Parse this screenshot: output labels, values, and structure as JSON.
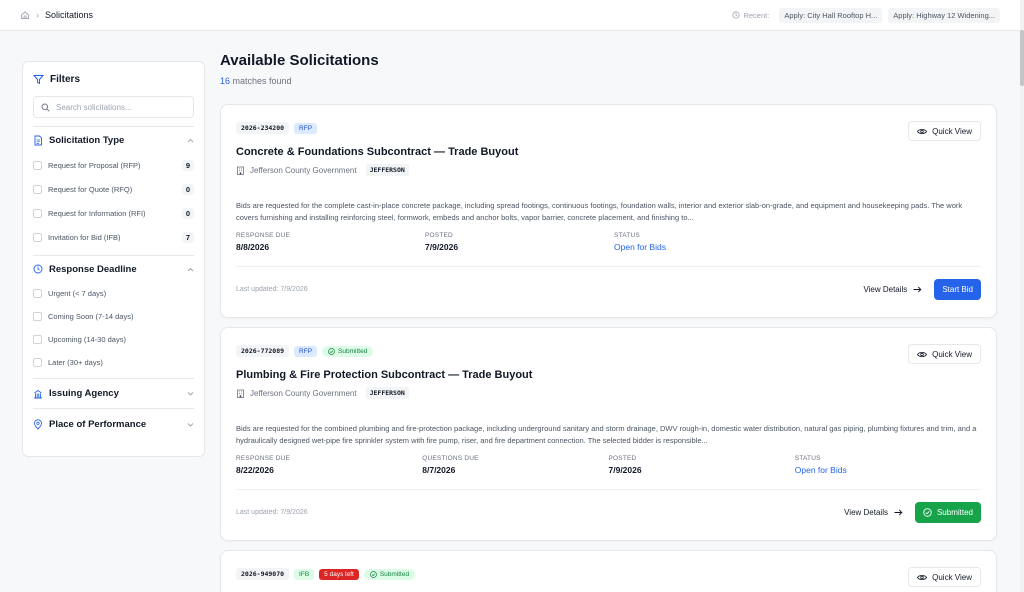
{
  "breadcrumb": {
    "current": "Solicitations"
  },
  "recent": {
    "label": "Recent:",
    "items": [
      "Apply: City Hall Rooftop H...",
      "Apply: Highway 12 Widening..."
    ]
  },
  "page": {
    "title": "Available Solicitations",
    "match_count": "16",
    "match_suffix": " matches found"
  },
  "filters": {
    "title": "Filters",
    "search_placeholder": "Search solicitations...",
    "solicitation_type": {
      "title": "Solicitation Type",
      "options": [
        {
          "label": "Request for Proposal (RFP)",
          "count": "9"
        },
        {
          "label": "Request for Quote (RFQ)",
          "count": "0"
        },
        {
          "label": "Request for Information (RFI)",
          "count": "0"
        },
        {
          "label": "Invitation for Bid (IFB)",
          "count": "7"
        }
      ]
    },
    "response_deadline": {
      "title": "Response Deadline",
      "options": [
        {
          "label": "Urgent (< 7 days)"
        },
        {
          "label": "Coming Soon (7-14 days)"
        },
        {
          "label": "Upcoming (14-30 days)"
        },
        {
          "label": "Later (30+ days)"
        }
      ]
    },
    "issuing_agency": {
      "title": "Issuing Agency"
    },
    "place_of_performance": {
      "title": "Place of Performance"
    }
  },
  "cards": [
    {
      "id": "2026-234200",
      "type": "RFP",
      "title": "Concrete & Foundations Subcontract — Trade Buyout",
      "agency": "Jefferson County Government",
      "county": "JEFFERSON",
      "description": "Bids are requested for the complete cast-in-place concrete package, including spread footings, continuous footings, foundation walls, interior and exterior slab-on-grade, and equipment and housekeeping pads. The work covers furnishing and installing reinforcing steel, formwork, embeds and anchor bolts, vapor barrier, concrete placement, and finishing to...",
      "meta": [
        {
          "label": "RESPONSE DUE",
          "value": "8/8/2026"
        },
        {
          "label": "POSTED",
          "value": "7/9/2026"
        },
        {
          "label": "STATUS",
          "value": "Open for Bids"
        }
      ],
      "updated": "Last updated: 7/9/2026",
      "view_details": "View Details",
      "action": "Start Bid",
      "quick_view": "Quick View"
    },
    {
      "id": "2026-772089",
      "type": "RFP",
      "badge": "Submitted",
      "title": "Plumbing & Fire Protection Subcontract — Trade Buyout",
      "agency": "Jefferson County Government",
      "county": "JEFFERSON",
      "description": "Bids are requested for the combined plumbing and fire-protection package, including underground sanitary and storm drainage, DWV rough-in, domestic water distribution, natural gas piping, plumbing fixtures and trim, and a hydraulically designed wet-pipe fire sprinkler system with fire pump, riser, and fire department connection. The selected bidder is responsible...",
      "meta": [
        {
          "label": "RESPONSE DUE",
          "value": "8/22/2026"
        },
        {
          "label": "QUESTIONS DUE",
          "value": "8/7/2026"
        },
        {
          "label": "POSTED",
          "value": "7/9/2026"
        },
        {
          "label": "STATUS",
          "value": "Open for Bids"
        }
      ],
      "updated": "Last updated: 7/9/2026",
      "view_details": "View Details",
      "action": "Submitted",
      "quick_view": "Quick View"
    },
    {
      "id": "2026-949070",
      "type": "IFB",
      "days_left": "5 days left",
      "badge": "Submitted",
      "quick_view": "Quick View"
    }
  ]
}
